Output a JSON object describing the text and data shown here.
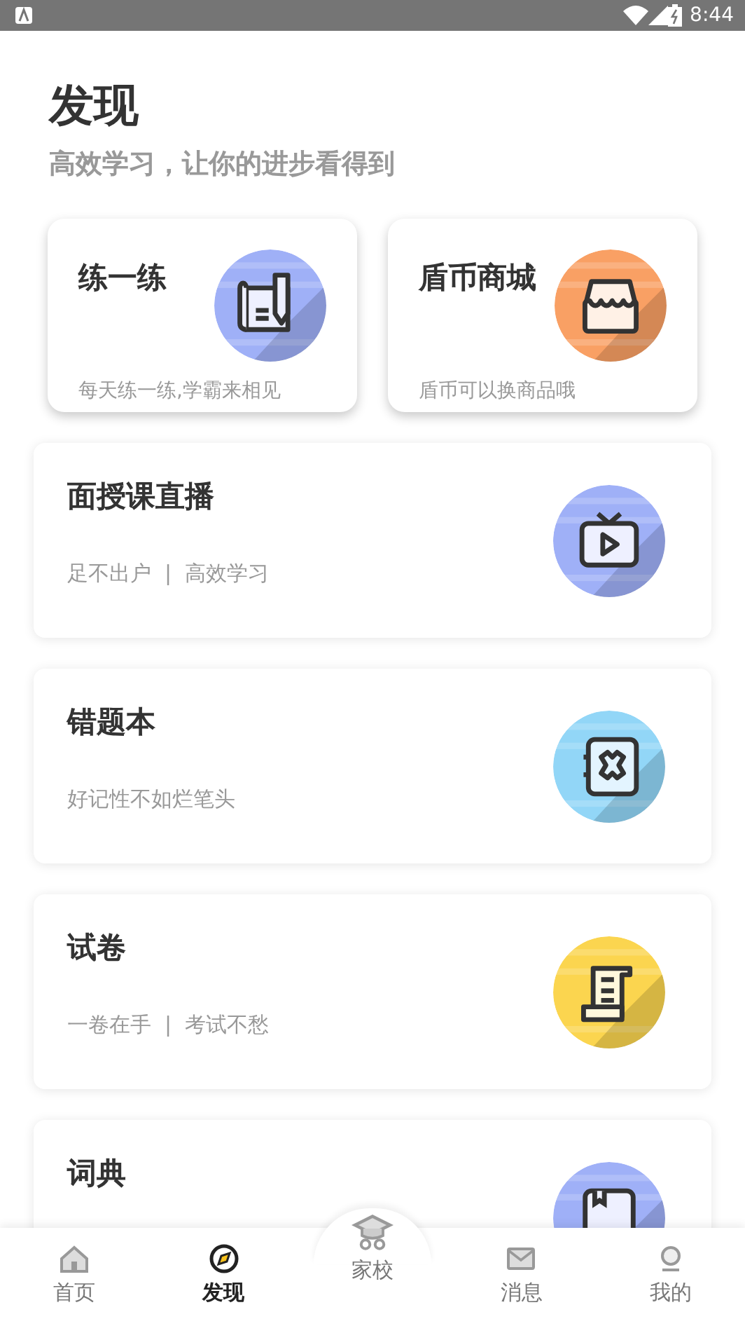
{
  "status_bar": {
    "time": "8:44"
  },
  "header": {
    "title": "发现",
    "subtitle": "高效学习，让你的进步看得到"
  },
  "quick_cards": [
    {
      "title": "练一练",
      "subtitle": "每天练一练,学霸来相见",
      "kind": "practice"
    },
    {
      "title": "盾币商城",
      "subtitle": "盾币可以换商品哦",
      "kind": "shop"
    }
  ],
  "feature_cards": [
    {
      "title": "面授课直播",
      "subtitle": "足不出户  |  高效学习",
      "kind": "tv"
    },
    {
      "title": "错题本",
      "subtitle": "好记性不如烂笔头",
      "kind": "notebook"
    },
    {
      "title": "试卷",
      "subtitle": "一卷在手  |  考试不愁",
      "kind": "scroll"
    },
    {
      "title": "词典",
      "kind": "dictionary"
    }
  ],
  "bottom_nav": [
    {
      "label": "首页",
      "kind": "home",
      "selected": false
    },
    {
      "label": "发现",
      "kind": "compass",
      "selected": true
    },
    {
      "label": "家校",
      "kind": "school",
      "selected": false
    },
    {
      "label": "消息",
      "kind": "mail",
      "selected": false
    },
    {
      "label": "我的",
      "kind": "user",
      "selected": false
    }
  ]
}
